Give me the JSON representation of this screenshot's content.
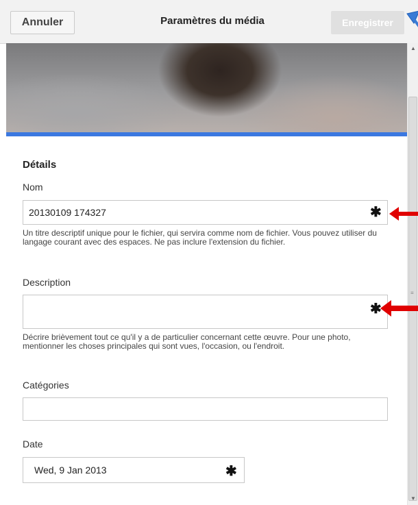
{
  "header": {
    "cancel_label": "Annuler",
    "title": "Paramètres du média",
    "save_label": "Enregistrer"
  },
  "details": {
    "section_title": "Détails",
    "name": {
      "label": "Nom",
      "value": "20130109 174327",
      "required_marker": "✱",
      "help": "Un titre descriptif unique pour le fichier, qui servira comme nom de fichier. Vous pouvez utiliser du langage courant avec des espaces. Ne pas inclure l'extension du fichier."
    },
    "description": {
      "label": "Description",
      "value": "",
      "required_marker": "✱",
      "help": "Décrire brièvement tout ce qu'il y a de particulier concernant cette œuvre. Pour une photo, mentionner les choses principales qui sont vues, l'occasion, ou l'endroit."
    },
    "categories": {
      "label": "Catégories",
      "value": ""
    },
    "date": {
      "label": "Date",
      "value": "Wed, 9 Jan 2013",
      "required_marker": "✱"
    }
  },
  "colors": {
    "accent_bar": "#3b78e0",
    "annotation_arrow": "#e00000",
    "pointer_arrow": "#3a7bd5"
  },
  "icons": {
    "pointer": "blue-arrow-icon",
    "annotation": "red-arrow-icon"
  }
}
